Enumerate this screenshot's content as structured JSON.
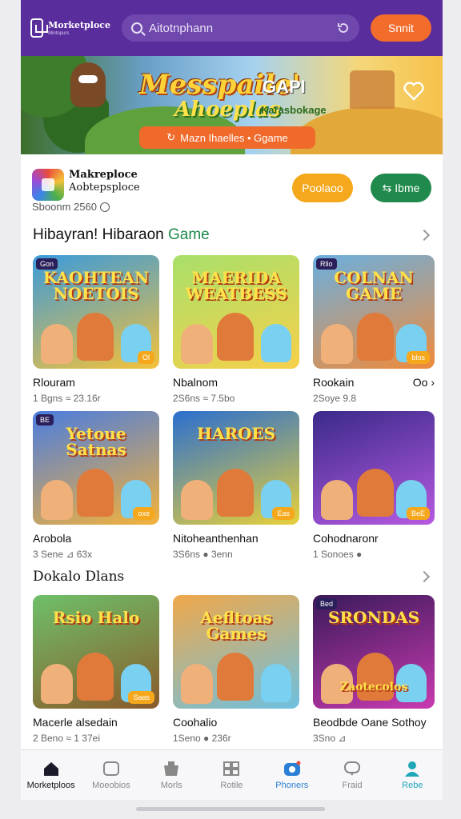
{
  "header": {
    "logo_title": "Morketploce",
    "logo_sub": "Mintopurs",
    "search_text": "Aitotnphann",
    "search_button": "Snnit"
  },
  "hero": {
    "title_line1": "Messpaile'",
    "title_line1b": "GAPI",
    "title_line2": "Ahoeplas",
    "title_line2b": "Karasbokage",
    "cta_label": "Mazn Ihaelles • Ggame"
  },
  "store_info": {
    "name_line1": "Makreploce",
    "name_line2": "Aobtepsploce",
    "stats": "Sboonm 2560",
    "primary_button": "Poolaoo",
    "secondary_button": "Ibme"
  },
  "section1": {
    "title_part1": "Hibayran! Hibaraon",
    "title_part2": "Game",
    "cards": [
      {
        "title": "KAOHTEAN NOETOIS",
        "tag": "Gon",
        "badge": "Ol",
        "name": "Rlouram",
        "meta": "1 Bgns ≈ 23.16r",
        "colors": [
          "#3a9bdc",
          "#f4c13a"
        ]
      },
      {
        "title": "MAERIDA WEATBESS",
        "tag": "",
        "badge": "",
        "name": "Nbalnom",
        "meta": "2S6ns ≈ 7.5bo",
        "colors": [
          "#a8e06a",
          "#f7d04a"
        ]
      },
      {
        "title": "COLNAN GAME",
        "tag": "Rllo",
        "badge": "blos",
        "name": "Rookain",
        "meta": "2Soye 9.8",
        "extra": "Oo",
        "colors": [
          "#6ab0e0",
          "#f08a3a"
        ]
      }
    ]
  },
  "section1b": {
    "cards": [
      {
        "title": "Yetoue Satnas",
        "tag": "BE",
        "badge": "oxe",
        "name": "Arobola",
        "meta": "3 Sene ⊿ 63x",
        "colors": [
          "#4a7de0",
          "#f4b23a"
        ]
      },
      {
        "title": "HAROES",
        "tag": "",
        "badge": "Eas",
        "name": "Nitoheanthenhan",
        "meta": "3S6ns ● 3enn",
        "colors": [
          "#2a6fd0",
          "#e8d03a"
        ]
      },
      {
        "title": "",
        "tag": "",
        "badge": "BeE",
        "name": "Cohodnaronr",
        "meta": "1 Sonoes ●",
        "colors": [
          "#3a2a8a",
          "#b65ae0"
        ]
      }
    ]
  },
  "section2": {
    "title": "Dokalo Dlans",
    "cards": [
      {
        "title": "Rsio Halo",
        "tag": "",
        "badge": "Saas",
        "name": "Macerle alsedain",
        "meta": "2 Beno ≈ 1 37ei",
        "colors": [
          "#6ec06a",
          "#8a5a2a"
        ]
      },
      {
        "title": "Aefltoas Games",
        "tag": "",
        "badge": "",
        "name": "Coohalio",
        "meta": "1Seno ● 236r",
        "colors": [
          "#f0a84a",
          "#6ec0e0"
        ]
      },
      {
        "title": "SRONDAS",
        "tag": "Bed",
        "badge": "",
        "name": "Beodbde Oane Sothoy",
        "meta": "3Sno ⊿",
        "subtitle": "Zaotecolos",
        "colors": [
          "#3a1a5a",
          "#c83ab0"
        ]
      }
    ]
  },
  "bottom_nav": [
    {
      "label": "Morketploos",
      "icon": "home-icon",
      "state": "active"
    },
    {
      "label": "Moeobios",
      "icon": "store-icon",
      "state": ""
    },
    {
      "label": "Morls",
      "icon": "shop-icon",
      "state": ""
    },
    {
      "label": "Rotile",
      "icon": "grid-icon",
      "state": ""
    },
    {
      "label": "Phoners",
      "icon": "camera-icon",
      "state": "blue"
    },
    {
      "label": "Fraid",
      "icon": "chat-icon",
      "state": ""
    },
    {
      "label": "Rebe",
      "icon": "profile-icon",
      "state": "teal"
    }
  ],
  "colors": {
    "header_bg": "#5a2d9c",
    "accent_orange": "#f26c2c",
    "accent_yellow": "#f5a81c",
    "accent_green": "#1f8a4c"
  }
}
